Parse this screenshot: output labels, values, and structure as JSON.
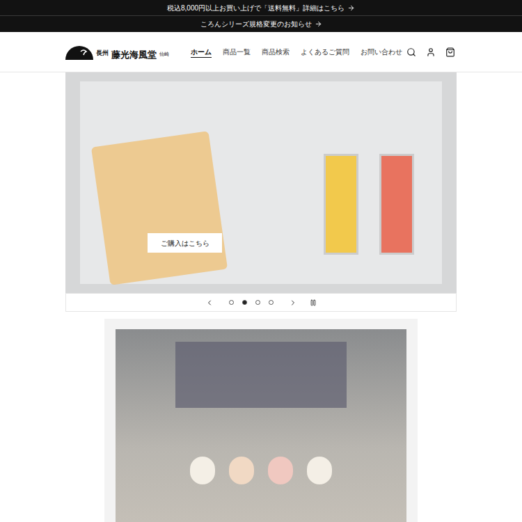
{
  "announcements": [
    {
      "text": "税込8,000円以上お買い上げで「送料無料」詳細はこちら"
    },
    {
      "text": "ころんシリーズ規格変更のお知らせ"
    }
  ],
  "logo": {
    "region": "長州",
    "name": "藤光海風堂",
    "place": "仙崎"
  },
  "nav": [
    {
      "label": "ホーム",
      "selected": true
    },
    {
      "label": "商品一覧",
      "selected": false
    },
    {
      "label": "商品検索",
      "selected": false
    },
    {
      "label": "よくあるご質問",
      "selected": false
    },
    {
      "label": "お問い合わせ",
      "selected": false
    }
  ],
  "slideshow": {
    "button": "ご購入はこちら",
    "dots": [
      {
        "selected": false
      },
      {
        "selected": true
      },
      {
        "selected": false
      },
      {
        "selected": false
      }
    ]
  }
}
